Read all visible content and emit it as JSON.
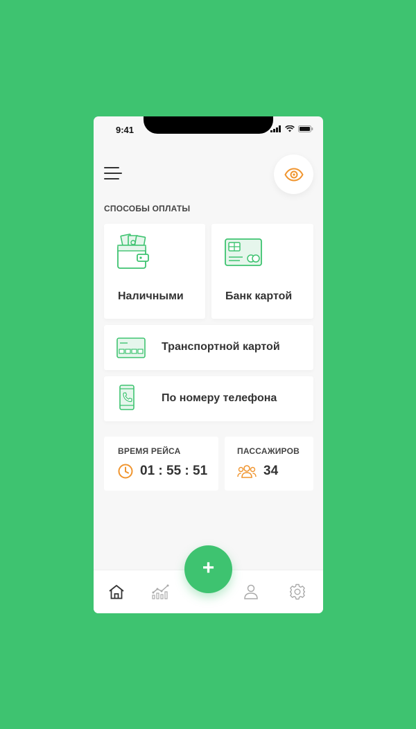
{
  "status_bar": {
    "time": "9:41"
  },
  "payment_methods": {
    "title": "СПОСОБЫ ОПЛАТЫ",
    "cash": {
      "label": "Наличными",
      "icon": "wallet-icon"
    },
    "bank_card": {
      "label": "Банк картой",
      "icon": "bank-card-icon"
    },
    "transport_card": {
      "label": "Транспортной картой",
      "icon": "transport-card-icon"
    },
    "phone_number": {
      "label": "По номеру телефона",
      "icon": "phone-icon"
    }
  },
  "trip_time": {
    "label": "ВРЕМЯ РЕЙСА",
    "value": "01 : 55 : 51",
    "icon": "clock-icon"
  },
  "passengers": {
    "label": "ПАССАЖИРОВ",
    "value": "34",
    "icon": "users-icon"
  },
  "tabbar": {
    "items": [
      "home-icon",
      "stats-icon",
      "profile-icon",
      "settings-icon"
    ]
  },
  "fab": {
    "label": "+"
  },
  "colors": {
    "brand_green": "#3ec370",
    "accent_orange": "#f0952f",
    "card_icon_green": "#3ec370"
  }
}
